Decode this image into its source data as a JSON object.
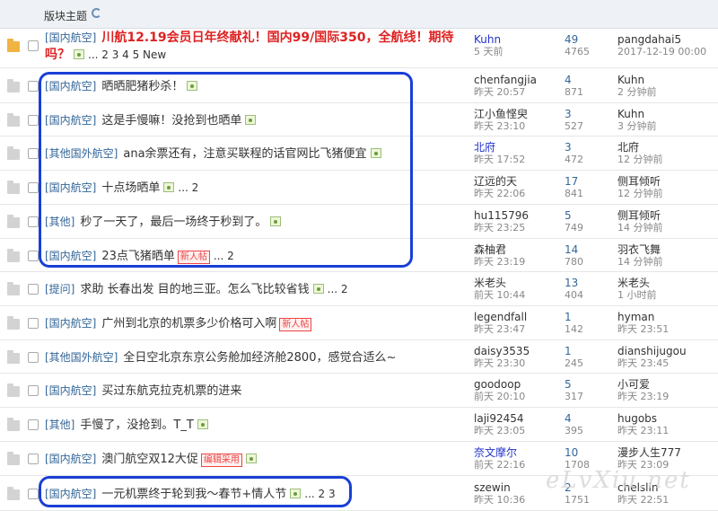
{
  "header": {
    "title": "版块主题"
  },
  "rows": [
    {
      "cat": "[国内航空]",
      "title": "川航12.19会员日年终献礼！国内99/国际350，全航线！期待吗？",
      "img": true,
      "pages": "... 2 3 4 5 New",
      "badge": "",
      "author": "Kuhn",
      "author_date": "5 天前",
      "replies": "49",
      "views": "4765",
      "last_user": "pangdahai5",
      "last_date": "2017-12-19 00:00"
    },
    {
      "cat": "[国内航空]",
      "title": "晒晒肥猪秒杀！",
      "img": true,
      "pages": "",
      "badge": "",
      "author": "chenfangjia",
      "author_date": "昨天 20:57",
      "replies": "4",
      "views": "871",
      "last_user": "Kuhn",
      "last_date": "2 分钟前"
    },
    {
      "cat": "[国内航空]",
      "title": "这是手慢嘛！没抢到也晒单",
      "img": true,
      "pages": "",
      "badge": "",
      "author": "江小鱼悭臾",
      "author_date": "昨天 23:10",
      "replies": "3",
      "views": "527",
      "last_user": "Kuhn",
      "last_date": "3 分钟前"
    },
    {
      "cat": "[其他国外航空]",
      "title": "ana余票还有，注意买联程的话官网比飞猪便宜",
      "img": true,
      "pages": "",
      "badge": "",
      "author": "北府",
      "author_date": "昨天 17:52",
      "replies": "3",
      "views": "472",
      "last_user": "北府",
      "last_date": "12 分钟前"
    },
    {
      "cat": "[国内航空]",
      "title": "十点场晒单",
      "img": true,
      "pages": "... 2",
      "badge": "",
      "author": "辽远的天",
      "author_date": "昨天 22:06",
      "replies": "17",
      "views": "841",
      "last_user": "侧耳倾听",
      "last_date": "12 分钟前"
    },
    {
      "cat": "[其他]",
      "title": "秒了一天了，最后一场终于秒到了。",
      "img": true,
      "pages": "",
      "badge": "",
      "author": "hu115796",
      "author_date": "昨天 23:25",
      "replies": "5",
      "views": "749",
      "last_user": "侧耳倾听",
      "last_date": "14 分钟前"
    },
    {
      "cat": "[国内航空]",
      "title": "23点飞猪晒单",
      "img": false,
      "pages": "... 2",
      "badge": "新人帖",
      "author": "森柚君",
      "author_date": "昨天 23:19",
      "replies": "14",
      "views": "780",
      "last_user": "羽衣飞舞",
      "last_date": "14 分钟前"
    },
    {
      "cat": "[提问]",
      "title": "求助 长春出发 目的地三亚。怎么飞比较省钱",
      "img": true,
      "pages": "... 2",
      "badge": "",
      "author": "米老头",
      "author_date": "前天 10:44",
      "replies": "13",
      "views": "404",
      "last_user": "米老头",
      "last_date": "1 小时前"
    },
    {
      "cat": "[国内航空]",
      "title": "广州到北京的机票多少价格可入啊",
      "img": false,
      "pages": "",
      "badge": "新人帖",
      "author": "legendfall",
      "author_date": "昨天 23:47",
      "replies": "1",
      "views": "142",
      "last_user": "hyman",
      "last_date": "昨天 23:51"
    },
    {
      "cat": "[其他国外航空]",
      "title": "全日空北京东京公务舱加经济舱2800，感觉合适么~",
      "img": false,
      "pages": "",
      "badge": "",
      "author": "daisy3535",
      "author_date": "昨天 23:30",
      "replies": "1",
      "views": "245",
      "last_user": "dianshijugou",
      "last_date": "昨天 23:45"
    },
    {
      "cat": "[国内航空]",
      "title": "买过东航克拉克机票的进来",
      "img": false,
      "pages": "",
      "badge": "",
      "author": "goodoop",
      "author_date": "前天 20:10",
      "replies": "5",
      "views": "317",
      "last_user": "小可爱",
      "last_date": "昨天 23:19"
    },
    {
      "cat": "[其他]",
      "title": "手慢了，没抢到。T_T",
      "img": true,
      "pages": "",
      "badge": "",
      "author": "laji92454",
      "author_date": "昨天 23:05",
      "replies": "4",
      "views": "395",
      "last_user": "hugobs",
      "last_date": "昨天 23:11"
    },
    {
      "cat": "[国内航空]",
      "title": "澳门航空双12大促",
      "img": true,
      "pages": "",
      "badge": "编辑采用",
      "author": "奈文摩尔",
      "author_date": "前天 22:16",
      "replies": "10",
      "views": "1708",
      "last_user": "漫步人生777",
      "last_date": "昨天 23:09"
    },
    {
      "cat": "[国内航空]",
      "title": "一元机票终于轮到我～春节+情人节",
      "img": true,
      "pages": "... 2 3",
      "badge": "",
      "author": "szewin",
      "author_date": "昨天 10:36",
      "replies": "2",
      "views": "1751",
      "last_user": "chelslin",
      "last_date": "昨天 22:51"
    }
  ],
  "watermark": "eLvXiu.net",
  "colors": {
    "highlight": "#1a3fd6",
    "category": "#336699",
    "hot_title": "#d22"
  }
}
